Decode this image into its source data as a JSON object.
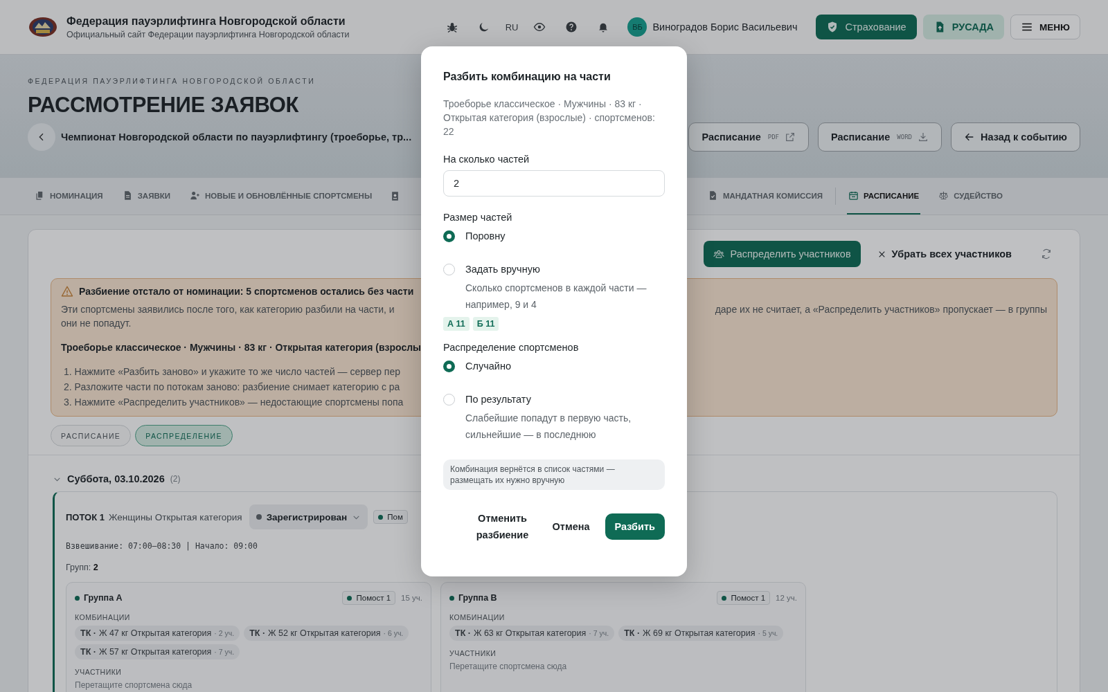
{
  "header": {
    "title": "Федерация пауэрлифтинга Новгородской области",
    "subtitle": "Официальный сайт Федерации пауэрлифтинга Новгородской области",
    "language": "RU",
    "user": {
      "initials": "ВБ",
      "name": "Виноградов Борис Васильевич"
    },
    "buttons": [
      {
        "label": "Страхование",
        "kind": "primary"
      },
      {
        "label": "РУСАДА",
        "kind": "soft"
      },
      {
        "label": "МЕНЮ",
        "kind": "outline"
      }
    ]
  },
  "hero": {
    "eyebrow": "ФЕДЕРАЦИЯ ПАУЭРЛИФТИНГА НОВГОРОДСКОЙ ОБЛАСТИ",
    "title": "РАССМОТРЕНИЕ ЗАЯВОК",
    "event_title": "Чемпионат Новгородской области по пауэрлифтингу (троеборье, тр...",
    "buttons": [
      {
        "label": "Расписание",
        "tag": "PDF",
        "kind": "external"
      },
      {
        "label": "Расписание",
        "tag": "WORD",
        "kind": "download"
      },
      {
        "label": "Назад к событию",
        "kind": "back"
      }
    ]
  },
  "tabs": [
    {
      "label": "НОМИНАЦИЯ",
      "selected": false
    },
    {
      "label": "ЗАЯВКИ",
      "selected": false
    },
    {
      "label": "НОВЫЕ И ОБНОВЛЁННЫЕ СПОРТСМЕНЫ",
      "selected": false
    },
    {
      "selected": false
    },
    {
      "label": "МАНДАТНАЯ КОМИССИЯ",
      "selected": false
    },
    {
      "label": "РАСПИСАНИЕ",
      "selected": true
    },
    {
      "label": "СУДЕЙСТВО",
      "selected": false
    }
  ],
  "toolbar": {
    "distribute": "Распределить участников",
    "clear": "Убрать всех участников"
  },
  "alert": {
    "title": "Разбиение отстало от номинации: 5 спортсменов остались без части",
    "text_left": "Эти спортсмены заявились после того, как категорию разбили на части, и",
    "text_right": "даре их не считает, а «Распределить участников» пропускает — в группы",
    "text_line2": "они не попадут.",
    "combination": "Троеборье классическое · Мужчины · 83 кг · Открытая категория (взрослы",
    "steps": [
      "1. Нажмите «Разбить заново» и укажите то же число частей — сервер пер",
      "2. Разложите части по потокам заново: разбиение снимает категорию с ра",
      "3. Нажмите «Распределить участников» — недостающие спортсмены попа"
    ]
  },
  "view_switch": [
    {
      "label": "РАСПИСАНИЕ",
      "selected": false
    },
    {
      "label": "РАСПРЕДЕЛЕНИЕ",
      "selected": true
    }
  ],
  "day": {
    "title": "Суббота, 03.10.2026",
    "count": "(2)",
    "expanded": true
  },
  "stream": {
    "label": "ПОТОК 1",
    "category": "Женщины Открытая категория",
    "status": "Зарегистрирован",
    "chip": "Пом",
    "schedule": "Взвешивание: 07:00–08:30 | Начало: 09:00",
    "groups": "Групп: **2**"
  },
  "groups": [
    {
      "name": "Группа А",
      "platform": "Помост 1",
      "count": "15 уч.",
      "combinations_label": "КОМБИНАЦИИ",
      "combinations": [
        {
          "prefix": "ТК ·",
          "name": "Ж 47 кг Открытая категория",
          "count": "· 2 уч."
        },
        {
          "prefix": "ТК ·",
          "name": "Ж 52 кг Открытая категория",
          "count": "· 6 уч."
        },
        {
          "prefix": "ТК ·",
          "name": "Ж 57 кг Открытая категория",
          "count": "· 7 уч."
        }
      ],
      "participants_label": "УЧАСТНИКИ",
      "drop_hint": "Перетащите спортсмена сюда"
    },
    {
      "name": "Группа B",
      "platform": "Помост 1",
      "count": "12 уч.",
      "combinations_label": "КОМБИНАЦИИ",
      "combinations": [
        {
          "prefix": "ТК ·",
          "name": "Ж 63 кг Открытая категория",
          "count": "· 7 уч."
        },
        {
          "prefix": "ТК ·",
          "name": "Ж 69 кг Открытая категория",
          "count": "· 5 уч."
        }
      ],
      "participants_label": "УЧАСТНИКИ",
      "drop_hint": "Перетащите спортсмена сюда"
    }
  ],
  "dialog": {
    "title": "Разбить комбинацию на части",
    "description": "Троеборье классическое · Мужчины · 83 кг · Открытая категория (взрослые) · спортсменов: 22",
    "parts_label": "На сколько частей",
    "parts_value": "2",
    "size_label": "Размер частей",
    "size_options": [
      {
        "label": "Поровну",
        "selected": true
      },
      {
        "label": "Задать вручную",
        "selected": false,
        "hint": "Сколько спортсменов в каждой части — например, 9 и 4"
      }
    ],
    "parts": [
      "А 11",
      "Б 11"
    ],
    "distribution_label": "Распределение спортсменов",
    "distribution_options": [
      {
        "label": "Случайно",
        "selected": true
      },
      {
        "label": "По результату",
        "selected": false,
        "hint": "Слабейшие попадут в первую часть, сильнейшие — в последнюю"
      }
    ],
    "note": "Комбинация вернётся в список частями — размещать их нужно вручную",
    "buttons": [
      {
        "label": "Отменить разбиение",
        "kind": "text"
      },
      {
        "label": "Отмена",
        "kind": "text"
      },
      {
        "label": "Разбить",
        "kind": "primary"
      }
    ]
  }
}
